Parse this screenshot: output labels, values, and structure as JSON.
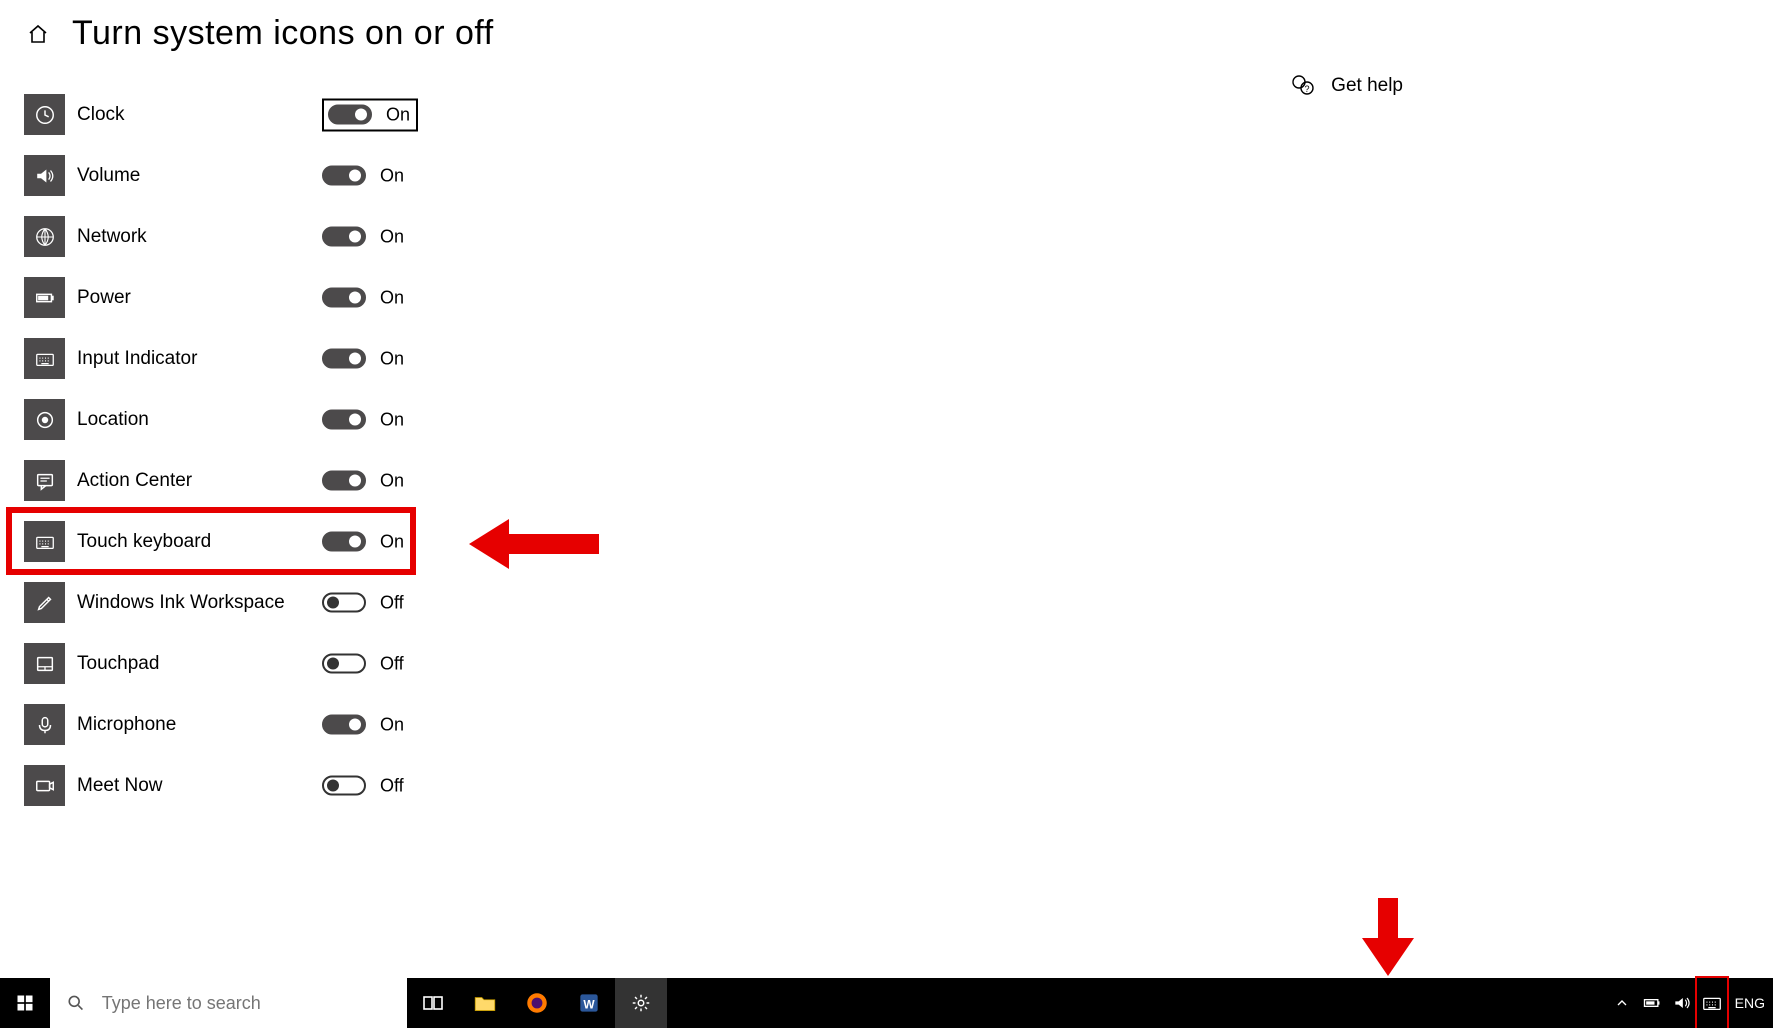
{
  "header": {
    "title": "Turn system icons on or off"
  },
  "help": {
    "label": "Get help"
  },
  "state_labels": {
    "on": "On",
    "off": "Off"
  },
  "items": [
    {
      "id": "clock",
      "label": "Clock",
      "state": "on",
      "icon": "clock-icon",
      "focused": true
    },
    {
      "id": "volume",
      "label": "Volume",
      "state": "on",
      "icon": "volume-icon"
    },
    {
      "id": "network",
      "label": "Network",
      "state": "on",
      "icon": "globe-icon"
    },
    {
      "id": "power",
      "label": "Power",
      "state": "on",
      "icon": "battery-icon"
    },
    {
      "id": "input",
      "label": "Input Indicator",
      "state": "on",
      "icon": "keyboard-icon"
    },
    {
      "id": "location",
      "label": "Location",
      "state": "on",
      "icon": "target-icon"
    },
    {
      "id": "action",
      "label": "Action Center",
      "state": "on",
      "icon": "message-icon"
    },
    {
      "id": "touchkbd",
      "label": "Touch keyboard",
      "state": "on",
      "icon": "keyboard-icon",
      "highlighted": true
    },
    {
      "id": "ink",
      "label": "Windows Ink Workspace",
      "state": "off",
      "icon": "pen-icon"
    },
    {
      "id": "touchpad",
      "label": "Touchpad",
      "state": "off",
      "icon": "touchpad-icon"
    },
    {
      "id": "mic",
      "label": "Microphone",
      "state": "on",
      "icon": "mic-icon"
    },
    {
      "id": "meetnow",
      "label": "Meet Now",
      "state": "off",
      "icon": "camera-icon"
    }
  ],
  "taskbar": {
    "search_placeholder": "Type here to search",
    "pinned": [
      "task-view-icon",
      "file-explorer-icon",
      "firefox-icon",
      "word-icon",
      "settings-icon"
    ],
    "tray": [
      "chevron-up-icon",
      "battery-icon",
      "volume-icon",
      "keyboard-icon"
    ],
    "lang": "ENG"
  },
  "annotations": {
    "highlight_row_id": "touchkbd",
    "arrow_left_target": "touchkbd",
    "arrow_down_target": "tray-keyboard"
  }
}
